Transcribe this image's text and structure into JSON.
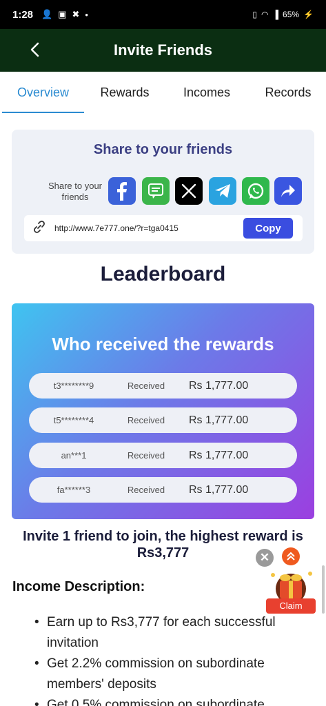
{
  "status_bar": {
    "time": "1:28",
    "battery": "65%"
  },
  "app_bar": {
    "title": "Invite Friends"
  },
  "tabs": [
    {
      "label": "Overview",
      "active": true
    },
    {
      "label": "Rewards",
      "active": false
    },
    {
      "label": "Incomes",
      "active": false
    },
    {
      "label": "Records",
      "active": false
    }
  ],
  "share": {
    "title": "Share to your friends",
    "label": "Share to your friends",
    "social_icons": [
      "facebook-icon",
      "message-icon",
      "x-icon",
      "telegram-icon",
      "whatsapp-icon",
      "share-arrow-icon"
    ],
    "link": "http://www.7e777.one/?r=tga0415",
    "copy_label": "Copy"
  },
  "leaderboard": {
    "title": "Leaderboard",
    "card_title": "Who received the rewards",
    "rows": [
      {
        "name": "t3********9",
        "status": "Received",
        "amount": "Rs  1,777.00"
      },
      {
        "name": "t5********4",
        "status": "Received",
        "amount": "Rs  1,777.00"
      },
      {
        "name": "an***1",
        "status": "Received",
        "amount": "Rs  1,777.00"
      },
      {
        "name": "fa******3",
        "status": "Received",
        "amount": "Rs  1,777.00"
      }
    ]
  },
  "invite": {
    "text": "Invite 1 friend to join, the highest reward is Rs3,777"
  },
  "income": {
    "title": "Income Description:",
    "items": [
      "Earn up to Rs3,777 for each successful invitation",
      "Get 2.2% commission on subordinate members' deposits",
      "Get 0.5% commission on subordinate"
    ]
  },
  "floating": {
    "claim_label": "Claim"
  },
  "colors": {
    "appbar": "#0b2e12",
    "accent": "#2a8bd1",
    "copy_button": "#3a4de0",
    "claim": "#e8402f"
  }
}
